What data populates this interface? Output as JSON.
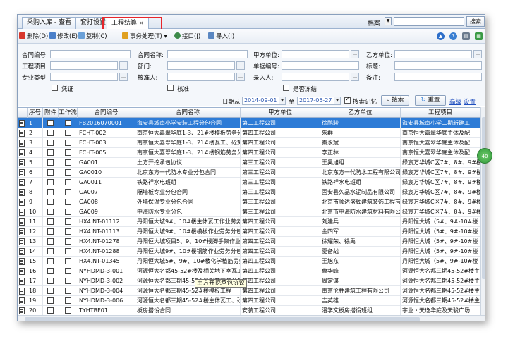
{
  "tabs": [
    {
      "label": "采购入库 - 查看"
    },
    {
      "label": "套打设置"
    },
    {
      "label": "工程结算",
      "close": "×"
    }
  ],
  "archive": {
    "label": "档案",
    "search_btn": "搜索"
  },
  "toolbar": {
    "delete": "删除(D)",
    "edit": "修改(E)",
    "copy": "复制(C)",
    "process": "事务处理(T)",
    "interface": "接口(J)",
    "import": "导入(I)"
  },
  "form": {
    "contract_no": "合同编号:",
    "contract_name": "合同名称:",
    "party_a": "甲方单位:",
    "party_b": "乙方单位:",
    "project": "工程项目:",
    "department": "部门:",
    "doc_no": "单据编号:",
    "title": "标题:",
    "specialty": "专业类型:",
    "auditor": "核准人:",
    "entry_person": "录入人:",
    "remark": "备注:",
    "voucher": "凭证",
    "approved": "核准",
    "frozen": "是否冻结",
    "date_label": "日期从",
    "date_from": "2014-09-01",
    "date_to_label": "至",
    "date_to": "2017-05-27",
    "search_memory": "搜索记忆",
    "search_btn": "搜索",
    "reset_btn": "重置",
    "advanced": "高级",
    "settings": "设置"
  },
  "grid": {
    "headers": [
      "序号",
      "附件",
      "工作流",
      "合同编号",
      "合同名称",
      "甲方单位",
      "乙方单位",
      "工程项目"
    ],
    "rows": [
      [
        "1",
        "FB2016070001",
        "海安县城南小学安装工程分包合同",
        "第二工程公司",
        "徐鹏骏",
        "海安县城南小学二期新建工"
      ],
      [
        "2",
        "FCHT-002",
        "南京恒大嘉翠华庭1-3、21#楼模板劳务分包",
        "第四工程公司",
        "朱群",
        "南京恒大嘉翠华庭主体及配"
      ],
      [
        "3",
        "FCHT-003",
        "南京恒大嘉翠华庭1-3、21#楼瓦工、砼劳务",
        "第四工程公司",
        "秦永斌",
        "南京恒大嘉翠华庭主体及配"
      ],
      [
        "4",
        "FCHT-005",
        "南京恒大嘉翠华庭1-3、21#楼钢筋劳务分包",
        "第四工程公司",
        "李正林",
        "南京恒大嘉翠华庭主体及配"
      ],
      [
        "5",
        "GA001",
        "土方开挖承包协议",
        "第三工程公司",
        "王昊旭组",
        "绿宸万华城C区7#、8#、9#楼"
      ],
      [
        "6",
        "GA0010",
        "北京东方一代防水专业分包合同",
        "第三工程公司",
        "北京东方一代防水工程有限公司",
        "绿宸万华城C区7#、8#、9#楼"
      ],
      [
        "7",
        "GA0011",
        "铁路祥水电班组",
        "第三工程公司",
        "铁路祥水电班组",
        "绿宸万华城C区7#、8#、9#楼"
      ],
      [
        "8",
        "GA007",
        "隔墙板专业分包合同",
        "第三工程公司",
        "固安县久晶水泥制品有限公司",
        "绿宸万华城C区7#、8#、9#楼"
      ],
      [
        "9",
        "GA008",
        "外墙保温专业分包合同",
        "第三工程公司",
        "北京市顺达盛辉建筑装饰工程有限",
        "绿宸万华城C区7#、8#、9#楼"
      ],
      [
        "10",
        "GA009",
        "中海防水专业分包",
        "第三工程公司",
        "北京市中海防水建筑材料有限公司",
        "绿宸万华城C区7#、8#、9#楼"
      ],
      [
        "11",
        "HX4.NT-01112",
        "丹阳恒大城9#、10#楼主体瓦工作业劳务分包",
        "第四工程公司",
        "刘建兵",
        "丹阳恒大城（5#、9#-10#楼"
      ],
      [
        "12",
        "HX4.NT-01113",
        "丹阳恒大城9#、10#楼模板作业劳务分包",
        "第四工程公司",
        "金四军",
        "丹阳恒大城（5#、9#-10#楼"
      ],
      [
        "13",
        "HX4.NT-01278",
        "丹阳恒大城项目5、9、10#楼脚手架作业",
        "第四工程公司",
        "徐耀荣、徐禹",
        "丹阳恒大城（5#、9#-10#楼"
      ],
      [
        "14",
        "HX4.NT-01288",
        "丹阳恒大城9#、10#楼钢筋作业劳务分包",
        "第四工程公司",
        "夏备战",
        "丹阳恒大城（5#、9#-10#楼"
      ],
      [
        "15",
        "HX4.NT-01345",
        "丹阳恒大城5#、9#、10#楼化学植筋劳务分包",
        "第四工程公司",
        "王旭东",
        "丹阳恒大城（5#、9#-10#楼"
      ],
      [
        "16",
        "NYHDMD-3-001",
        "河源恒大名都45-52#楼及相关地下室瓦工劳",
        "第四工程公司",
        "曹华峰",
        "河源恒大名都三期45-52#楼主"
      ],
      [
        "17",
        "NYHDMD-3-002",
        "河源恒大名都三期45-52#楼钢筋劳务分包工程",
        "第四工程公司",
        "周定谋",
        "河源恒大名都三期45-52#楼主"
      ],
      [
        "18",
        "NYHDMD-3-004",
        "河源恒大名都三期45-52#楼模板工程",
        "第四工程公司",
        "南京伦胜建筑工程有限公司",
        "河源恒大名都三期45-52#楼主"
      ],
      [
        "19",
        "NYHDMD-3-006",
        "河源恒大名都三期45-52#楼主体瓦工、砼劳务",
        "第四工程公司",
        "吉英雄",
        "河源恒大名都三期45-52#楼主"
      ],
      [
        "20",
        "TYHTBF01",
        "板房搭设合同",
        "安装工程公司",
        "潘学文板房搭设班组",
        "宇业・天逸华庭及天骏广场"
      ]
    ]
  },
  "tooltip": "土方开挖承包协议",
  "side_badge": "40",
  "colors": {
    "accent": "#2d7bd6",
    "highlight": "#e8252a",
    "link": "#1f4fbf"
  }
}
